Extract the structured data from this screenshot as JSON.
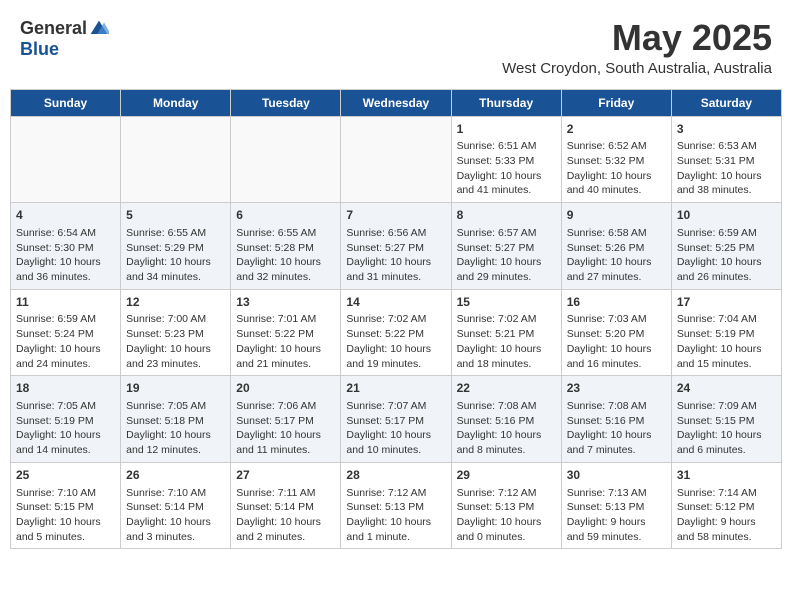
{
  "header": {
    "logo_general": "General",
    "logo_blue": "Blue",
    "month_year": "May 2025",
    "location": "West Croydon, South Australia, Australia"
  },
  "weekdays": [
    "Sunday",
    "Monday",
    "Tuesday",
    "Wednesday",
    "Thursday",
    "Friday",
    "Saturday"
  ],
  "weeks": [
    [
      {
        "day": "",
        "text": ""
      },
      {
        "day": "",
        "text": ""
      },
      {
        "day": "",
        "text": ""
      },
      {
        "day": "",
        "text": ""
      },
      {
        "day": "1",
        "text": "Sunrise: 6:51 AM\nSunset: 5:33 PM\nDaylight: 10 hours\nand 41 minutes."
      },
      {
        "day": "2",
        "text": "Sunrise: 6:52 AM\nSunset: 5:32 PM\nDaylight: 10 hours\nand 40 minutes."
      },
      {
        "day": "3",
        "text": "Sunrise: 6:53 AM\nSunset: 5:31 PM\nDaylight: 10 hours\nand 38 minutes."
      }
    ],
    [
      {
        "day": "4",
        "text": "Sunrise: 6:54 AM\nSunset: 5:30 PM\nDaylight: 10 hours\nand 36 minutes."
      },
      {
        "day": "5",
        "text": "Sunrise: 6:55 AM\nSunset: 5:29 PM\nDaylight: 10 hours\nand 34 minutes."
      },
      {
        "day": "6",
        "text": "Sunrise: 6:55 AM\nSunset: 5:28 PM\nDaylight: 10 hours\nand 32 minutes."
      },
      {
        "day": "7",
        "text": "Sunrise: 6:56 AM\nSunset: 5:27 PM\nDaylight: 10 hours\nand 31 minutes."
      },
      {
        "day": "8",
        "text": "Sunrise: 6:57 AM\nSunset: 5:27 PM\nDaylight: 10 hours\nand 29 minutes."
      },
      {
        "day": "9",
        "text": "Sunrise: 6:58 AM\nSunset: 5:26 PM\nDaylight: 10 hours\nand 27 minutes."
      },
      {
        "day": "10",
        "text": "Sunrise: 6:59 AM\nSunset: 5:25 PM\nDaylight: 10 hours\nand 26 minutes."
      }
    ],
    [
      {
        "day": "11",
        "text": "Sunrise: 6:59 AM\nSunset: 5:24 PM\nDaylight: 10 hours\nand 24 minutes."
      },
      {
        "day": "12",
        "text": "Sunrise: 7:00 AM\nSunset: 5:23 PM\nDaylight: 10 hours\nand 23 minutes."
      },
      {
        "day": "13",
        "text": "Sunrise: 7:01 AM\nSunset: 5:22 PM\nDaylight: 10 hours\nand 21 minutes."
      },
      {
        "day": "14",
        "text": "Sunrise: 7:02 AM\nSunset: 5:22 PM\nDaylight: 10 hours\nand 19 minutes."
      },
      {
        "day": "15",
        "text": "Sunrise: 7:02 AM\nSunset: 5:21 PM\nDaylight: 10 hours\nand 18 minutes."
      },
      {
        "day": "16",
        "text": "Sunrise: 7:03 AM\nSunset: 5:20 PM\nDaylight: 10 hours\nand 16 minutes."
      },
      {
        "day": "17",
        "text": "Sunrise: 7:04 AM\nSunset: 5:19 PM\nDaylight: 10 hours\nand 15 minutes."
      }
    ],
    [
      {
        "day": "18",
        "text": "Sunrise: 7:05 AM\nSunset: 5:19 PM\nDaylight: 10 hours\nand 14 minutes."
      },
      {
        "day": "19",
        "text": "Sunrise: 7:05 AM\nSunset: 5:18 PM\nDaylight: 10 hours\nand 12 minutes."
      },
      {
        "day": "20",
        "text": "Sunrise: 7:06 AM\nSunset: 5:17 PM\nDaylight: 10 hours\nand 11 minutes."
      },
      {
        "day": "21",
        "text": "Sunrise: 7:07 AM\nSunset: 5:17 PM\nDaylight: 10 hours\nand 10 minutes."
      },
      {
        "day": "22",
        "text": "Sunrise: 7:08 AM\nSunset: 5:16 PM\nDaylight: 10 hours\nand 8 minutes."
      },
      {
        "day": "23",
        "text": "Sunrise: 7:08 AM\nSunset: 5:16 PM\nDaylight: 10 hours\nand 7 minutes."
      },
      {
        "day": "24",
        "text": "Sunrise: 7:09 AM\nSunset: 5:15 PM\nDaylight: 10 hours\nand 6 minutes."
      }
    ],
    [
      {
        "day": "25",
        "text": "Sunrise: 7:10 AM\nSunset: 5:15 PM\nDaylight: 10 hours\nand 5 minutes."
      },
      {
        "day": "26",
        "text": "Sunrise: 7:10 AM\nSunset: 5:14 PM\nDaylight: 10 hours\nand 3 minutes."
      },
      {
        "day": "27",
        "text": "Sunrise: 7:11 AM\nSunset: 5:14 PM\nDaylight: 10 hours\nand 2 minutes."
      },
      {
        "day": "28",
        "text": "Sunrise: 7:12 AM\nSunset: 5:13 PM\nDaylight: 10 hours\nand 1 minute."
      },
      {
        "day": "29",
        "text": "Sunrise: 7:12 AM\nSunset: 5:13 PM\nDaylight: 10 hours\nand 0 minutes."
      },
      {
        "day": "30",
        "text": "Sunrise: 7:13 AM\nSunset: 5:13 PM\nDaylight: 9 hours\nand 59 minutes."
      },
      {
        "day": "31",
        "text": "Sunrise: 7:14 AM\nSunset: 5:12 PM\nDaylight: 9 hours\nand 58 minutes."
      }
    ]
  ]
}
